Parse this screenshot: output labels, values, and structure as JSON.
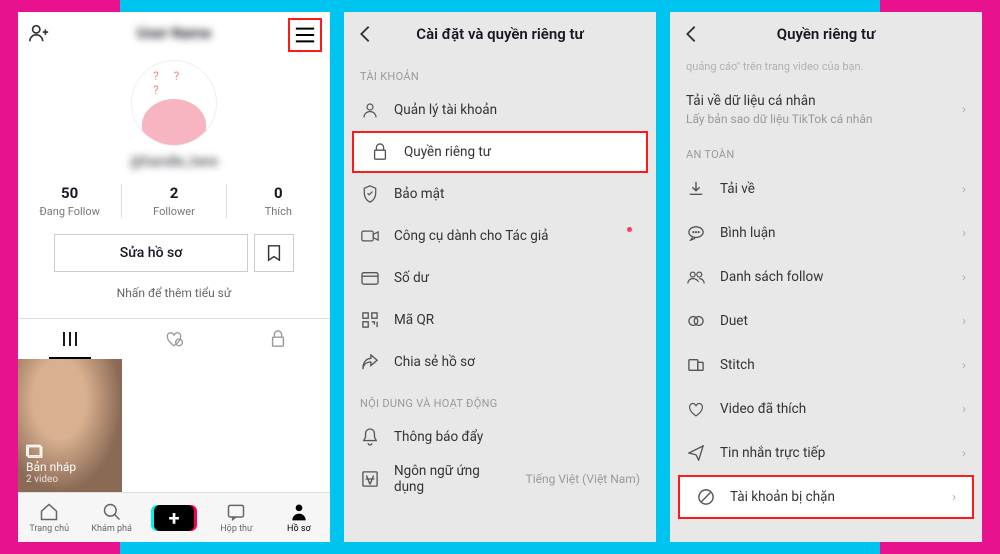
{
  "panel1": {
    "stats": [
      {
        "n": "50",
        "l": "Đang Follow"
      },
      {
        "n": "2",
        "l": "Follower"
      },
      {
        "n": "0",
        "l": "Thích"
      }
    ],
    "edit": "Sửa hồ sơ",
    "bio": "Nhấn để thêm tiểu sử",
    "draft": {
      "title": "Bản nháp",
      "sub": "2 video"
    },
    "nav": [
      "Trang chủ",
      "Khám phá",
      "",
      "Hộp thư",
      "Hồ sơ"
    ]
  },
  "panel2": {
    "title": "Cài đặt và quyền riêng tư",
    "sec1": "TÀI KHOẢN",
    "items1": [
      "Quản lý tài khoản",
      "Quyền riêng tư",
      "Bảo mật",
      "Công cụ dành cho Tác giả",
      "Số dư",
      "Mã QR",
      "Chia sẻ hồ sơ"
    ],
    "sec2": "NỘI DUNG VÀ HOẠT ĐỘNG",
    "items2": [
      "Thông báo đẩy",
      "Ngôn ngữ ứng dụng"
    ],
    "lang": "Tiếng Việt (Việt Nam)"
  },
  "panel3": {
    "title": "Quyền riêng tư",
    "note": "quảng cáo\" trên trang video của bạn.",
    "dl": {
      "title": "Tải về dữ liệu cá nhân",
      "sub": "Lấy bản sao dữ liệu TikTok cá nhân"
    },
    "sec": "AN TOÀN",
    "items": [
      "Tải về",
      "Bình luận",
      "Danh sách follow",
      "Duet",
      "Stitch",
      "Video đã thích",
      "Tin nhắn trực tiếp",
      "Tài khoản bị chặn"
    ]
  }
}
